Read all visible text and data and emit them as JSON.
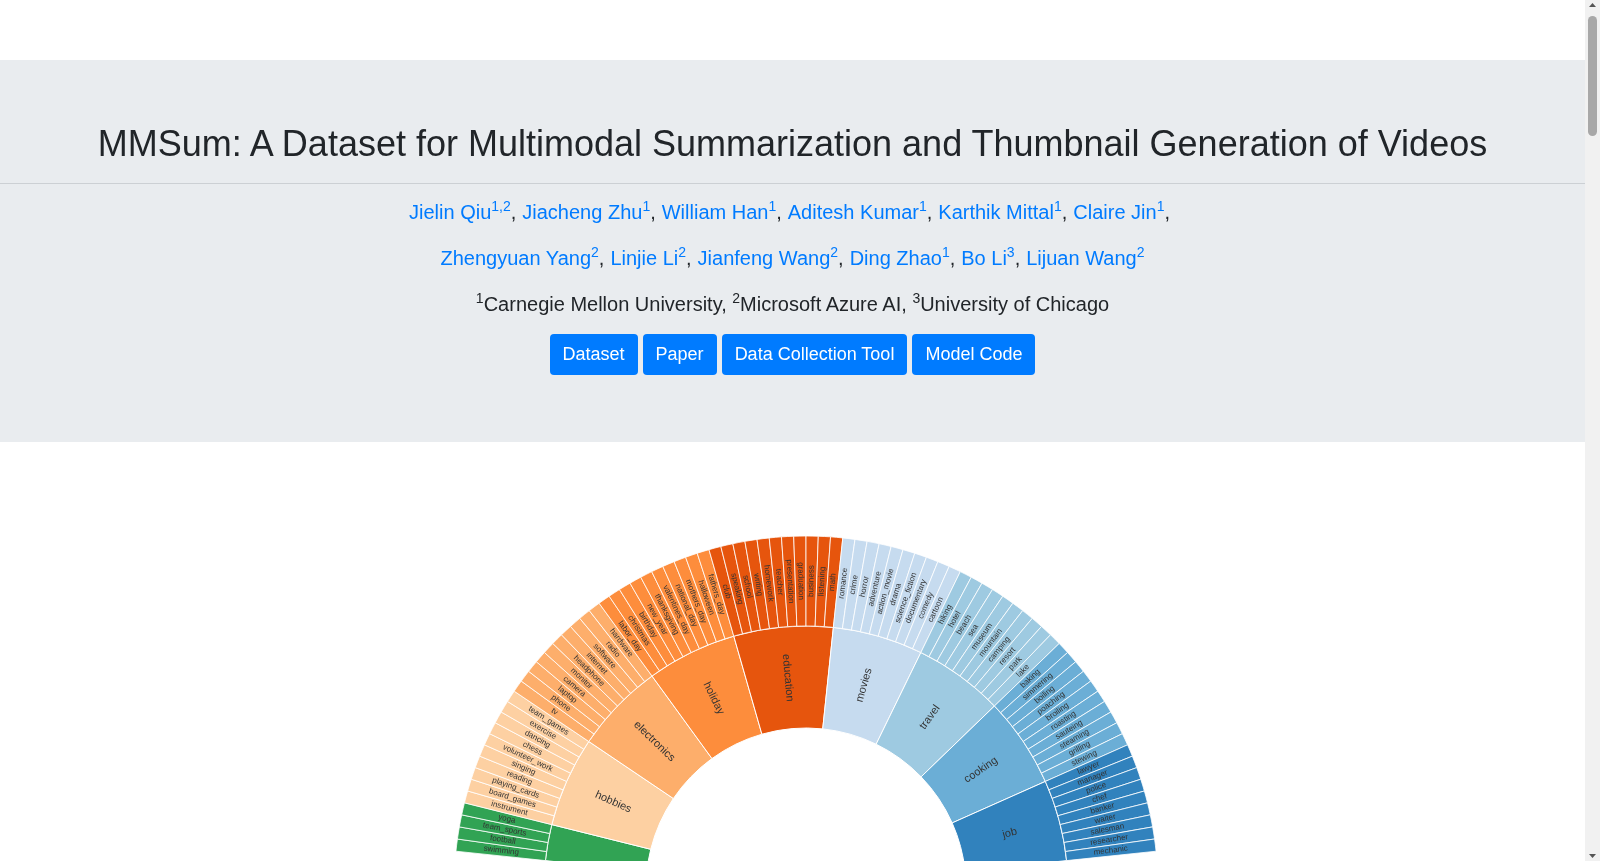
{
  "header": {
    "title": "MMSum: A Dataset for Multimodal Summarization and Thumbnail Generation of Videos",
    "author_lines": [
      [
        {
          "name": "Jielin Qiu",
          "affiliations": "1,2",
          "separator": ","
        },
        {
          "name": "Jiacheng Zhu",
          "affiliations": "1",
          "separator": ","
        },
        {
          "name": "William Han",
          "affiliations": "1",
          "separator": ","
        },
        {
          "name": "Aditesh Kumar",
          "affiliations": "1",
          "separator": ","
        },
        {
          "name": "Karthik Mittal",
          "affiliations": "1",
          "separator": ","
        },
        {
          "name": "Claire Jin",
          "affiliations": "1",
          "separator": ","
        }
      ],
      [
        {
          "name": "Zhengyuan Yang",
          "affiliations": "2",
          "separator": ","
        },
        {
          "name": "Linjie Li",
          "affiliations": "2",
          "separator": ","
        },
        {
          "name": "Jianfeng Wang",
          "affiliations": "2",
          "separator": ","
        },
        {
          "name": "Ding Zhao",
          "affiliations": "1",
          "separator": ","
        },
        {
          "name": "Bo Li",
          "affiliations": "3",
          "separator": ","
        },
        {
          "name": "Lijuan Wang",
          "affiliations": "2"
        }
      ]
    ],
    "affiliations": "$^{1}$Carnegie Mellon University, $^{2}$Microsoft Azure AI, $^{3}$University of Chicago",
    "buttons": [
      "Dataset",
      "Paper",
      "Data Collection Tool",
      "Model Code"
    ]
  },
  "sunburst": {
    "categories": [
      {
        "color": "#31a354",
        "children": [
          "swimming",
          "football",
          "team_sports",
          "yoga"
        ]
      },
      {
        "label": "hobbies",
        "color": "#fdd0a2",
        "children": [
          "instrument",
          "board_games",
          "playing_cards",
          "reading",
          "singing",
          "volunteer_work",
          "chess",
          "dancing",
          "exercise",
          "team_games"
        ]
      },
      {
        "label": "electronics",
        "color": "#fdae6b",
        "children": [
          "tv",
          "phone",
          "laptop",
          "camera",
          "monitor",
          "headphone",
          "internet",
          "software",
          "radio",
          "hardware"
        ]
      },
      {
        "label": "holiday",
        "color": "#fd8d3c",
        "children": [
          "labor_day",
          "christmas",
          "birthday",
          "new_year",
          "thanksgiving",
          "valentines_day",
          "national_day",
          "mothers_day",
          "halloween",
          "fathers_day"
        ]
      },
      {
        "label": "education",
        "color": "#e6550d",
        "children": [
          "club",
          "speaking",
          "school",
          "writing",
          "homework",
          "teacher",
          "presentation",
          "graduation",
          "business",
          "listening",
          "math"
        ]
      },
      {
        "label": "movies",
        "color": "#c6dbef",
        "children": [
          "romance",
          "crime",
          "horror",
          "adventure",
          "action_movie",
          "drama",
          "science_fiction",
          "documentary",
          "comedy",
          "cartoon"
        ]
      },
      {
        "label": "travel",
        "color": "#9ecae1",
        "children": [
          "hiking",
          "hotel",
          "beach",
          "sea",
          "museum",
          "mountain",
          "camping",
          "resort",
          "park",
          "lake"
        ]
      },
      {
        "label": "cooking",
        "color": "#6baed6",
        "children": [
          "baking",
          "simmering",
          "boiling",
          "poaching",
          "broiling",
          "roasting",
          "sauteing",
          "steaming",
          "grilling",
          "stewing"
        ]
      },
      {
        "label": "job",
        "color": "#3182bd",
        "children": [
          "lawyer",
          "manager",
          "police",
          "chef",
          "banker",
          "waiter",
          "salesman",
          "researcher",
          "mechanic"
        ]
      }
    ]
  }
}
